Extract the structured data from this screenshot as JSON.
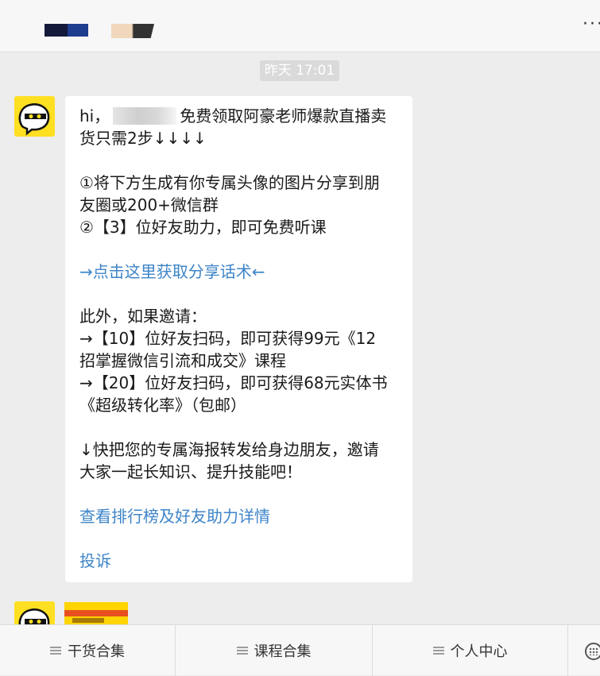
{
  "header": {
    "more_icon": "more-dots-icon"
  },
  "timestamp": "昨天 17:01",
  "message": {
    "greeting_prefix": "hi，",
    "greeting_suffix": "免费领取阿豪老师爆款直播卖",
    "line2": "货只需2步↓↓↓↓",
    "step1_a": "①将下方生成有你专属头像的图片分享到朋",
    "step1_b": "友圈或200+微信群",
    "step2": "②【3】位好友助力，即可免费听课",
    "share_link": "→点击这里获取分享话术←",
    "invite_title": "此外，如果邀请：",
    "reward1_a": "→【10】位好友扫码，即可获得99元《12",
    "reward1_b": "招掌握微信引流和成交》课程",
    "reward2_a": "→【20】位好友扫码，即可获得68元实体书",
    "reward2_b": "《超级转化率》（包邮）",
    "forward_a": "↓快把您的专属海报转发给身边朋友，邀请",
    "forward_b": "大家一起长知识、提升技能吧！",
    "ranking_link": "查看排行榜及好友助力详情",
    "complaint_link": "投诉"
  },
  "menu": {
    "items": [
      {
        "label": "干货合集",
        "icon": "menu-list-icon"
      },
      {
        "label": "课程合集",
        "icon": "menu-list-icon"
      },
      {
        "label": "个人中心",
        "icon": "menu-list-icon"
      }
    ],
    "keyboard_icon": "keyboard-icon"
  },
  "colors": {
    "link": "#3d84c8",
    "avatar_bg": "#ffdf21",
    "background": "#ededed"
  }
}
